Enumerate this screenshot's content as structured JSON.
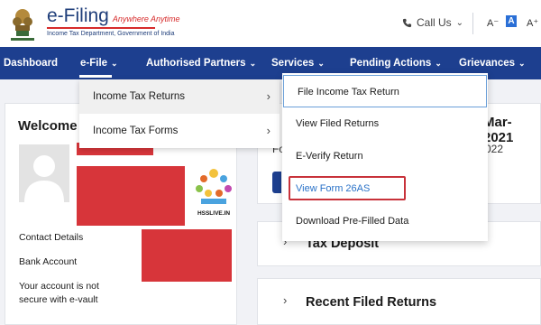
{
  "header": {
    "brand_title": "e-Filing",
    "brand_tagline": "Anywhere Anytime",
    "brand_subtitle": "Income Tax Department, Government of India",
    "call_us": "Call Us",
    "font_decrease": "A⁻",
    "font_normal": "A",
    "font_increase": "A⁺"
  },
  "nav": {
    "dashboard": "Dashboard",
    "efile": "e-File",
    "authorised_partners": "Authorised Partners",
    "services": "Services",
    "pending_actions": "Pending Actions",
    "grievances": "Grievances",
    "chevron": "⌄",
    "active_item": "e-File"
  },
  "efile_menu": {
    "items": [
      {
        "label": "Income Tax Returns",
        "arrow": "›"
      },
      {
        "label": "Income Tax Forms",
        "arrow": "›"
      }
    ]
  },
  "services_menu": {
    "items": [
      {
        "label": "File Income Tax Return"
      },
      {
        "label": "View Filed Returns"
      },
      {
        "label": "E-Verify Return"
      },
      {
        "label": "View Form 26AS"
      },
      {
        "label": "Download Pre-Filled Data"
      }
    ]
  },
  "welcome": {
    "title": "Welcome E",
    "contact_details": "Contact Details",
    "bank_account": "Bank Account",
    "vault_line1": "Your account is not",
    "vault_line2": "secure with e-vault"
  },
  "watermark": {
    "label": "HSSLIVE.IN"
  },
  "summary": {
    "date_fragment": "Mar-2021",
    "fo_fragment": "Fo",
    "year_fragment": "022"
  },
  "sections": {
    "tax_deposit": "Tax Deposit",
    "recent_filed_returns": "Recent Filed Returns",
    "arrow": "›"
  },
  "colors": {
    "nav_bg": "#1d3f8f",
    "link_blue": "#2a72c8",
    "highlight_red": "#c8323a",
    "redaction_red": "#d7353a",
    "brand_red": "#d62b2b"
  }
}
